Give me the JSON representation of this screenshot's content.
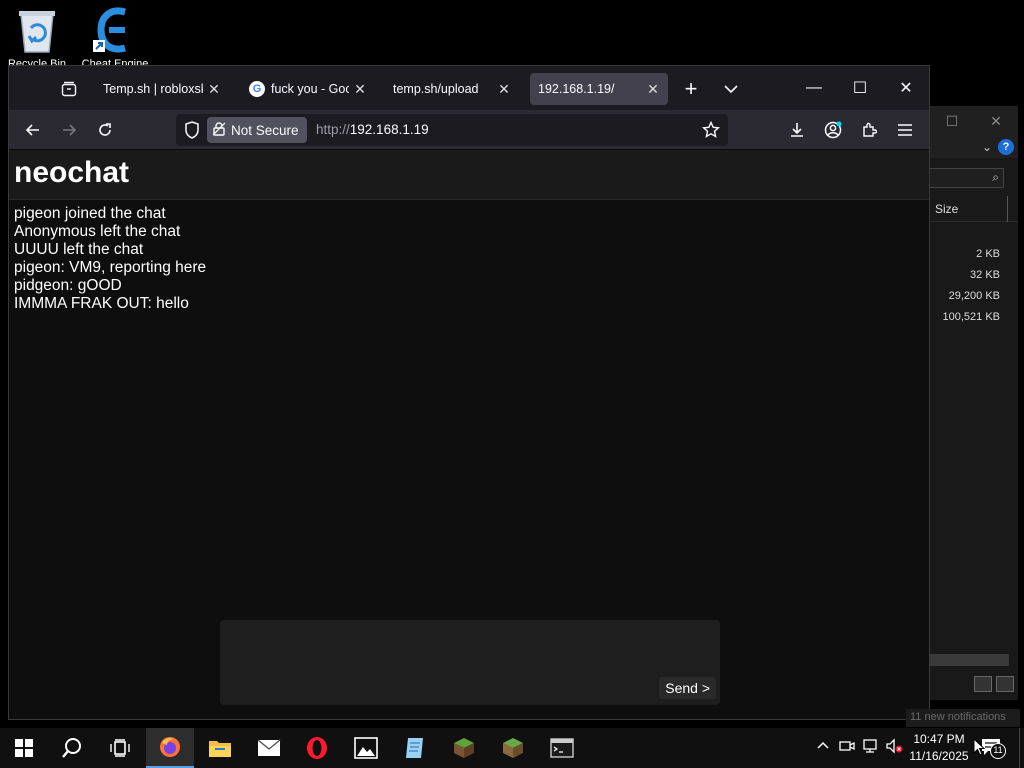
{
  "desktop": {
    "icons": [
      {
        "label": "Recycle Bin"
      },
      {
        "label": "Cheat Engine"
      }
    ]
  },
  "explorer": {
    "size_header": "Size",
    "file_sizes": [
      "2 KB",
      "32 KB",
      "29,200 KB",
      "100,521 KB"
    ],
    "help_label": "?"
  },
  "browser": {
    "tabs": [
      {
        "title": "Temp.sh | robloxskyblock",
        "active": false
      },
      {
        "title": "fuck you - Google Search",
        "active": false
      },
      {
        "title": "temp.sh/upload",
        "active": false
      },
      {
        "title": "192.168.1.19/",
        "active": true
      }
    ],
    "security_label": "Not Secure",
    "url_scheme": "http://",
    "url_host": "192.168.1.19"
  },
  "page": {
    "title": "neochat",
    "messages": [
      "pigeon joined the chat",
      "Anonymous left the chat",
      "UUUU left the chat",
      "pigeon: VM9, reporting here",
      "pidgeon: gOOD",
      "IMMMA FRAK OUT: hello"
    ],
    "composer_value": "",
    "send_label": "Send >"
  },
  "taskbar": {
    "time": "10:47 PM",
    "date": "11/16/2025",
    "notification_count": "11",
    "notification_toast": "11 new notifications"
  },
  "colors": {
    "page_bg": "#0e0e0e",
    "header_bg": "#1a1a1a",
    "browser_chrome": "#1c1b22",
    "active_tab": "#42414d",
    "taskbar": "#101010"
  }
}
